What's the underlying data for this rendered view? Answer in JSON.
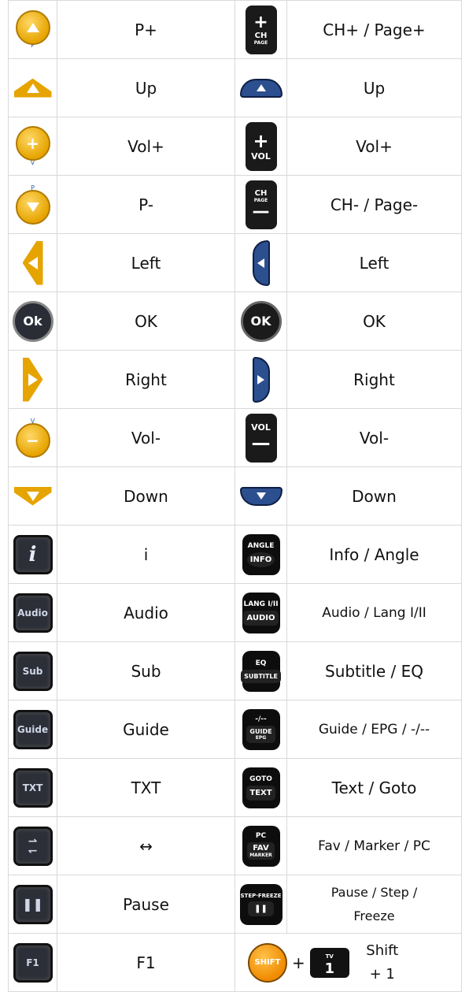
{
  "rows": [
    {
      "left_icon": "yellow-p-up-icon",
      "left_label": "P+",
      "right_icon": "ch-page-plus-icon",
      "right_label": "CH+ / Page+"
    },
    {
      "left_icon": "yellow-up-arrow-icon",
      "left_label": "Up",
      "right_icon": "blue-up-arrow-icon",
      "right_label": "Up"
    },
    {
      "left_icon": "yellow-vol-plus-icon",
      "left_label": "Vol+",
      "right_icon": "vol-plus-icon",
      "right_label": "Vol+"
    },
    {
      "left_icon": "yellow-p-down-icon",
      "left_label": "P-",
      "right_icon": "ch-page-minus-icon",
      "right_label": "CH- / Page-"
    },
    {
      "left_icon": "yellow-left-arrow-icon",
      "left_label": "Left",
      "right_icon": "blue-left-arrow-icon",
      "right_label": "Left"
    },
    {
      "left_icon": "ok-icon",
      "left_label": "OK",
      "right_icon": "ok-black-icon",
      "right_label": "OK"
    },
    {
      "left_icon": "yellow-right-arrow-icon",
      "left_label": "Right",
      "right_icon": "blue-right-arrow-icon",
      "right_label": "Right"
    },
    {
      "left_icon": "yellow-vol-minus-icon",
      "left_label": "Vol-",
      "right_icon": "vol-minus-icon",
      "right_label": "Vol-"
    },
    {
      "left_icon": "yellow-down-arrow-icon",
      "left_label": "Down",
      "right_icon": "blue-down-arrow-icon",
      "right_label": "Down"
    },
    {
      "left_icon": "info-i-icon",
      "left_label": "i",
      "right_icon": "info-angle-icon",
      "right_label": "Info / Angle"
    },
    {
      "left_icon": "audio-icon",
      "left_label": "Audio",
      "right_icon": "audio-lang-icon",
      "right_label": "Audio / Lang I/II"
    },
    {
      "left_icon": "sub-icon",
      "left_label": "Sub",
      "right_icon": "subtitle-eq-icon",
      "right_label": "Subtitle / EQ"
    },
    {
      "left_icon": "guide-icon",
      "left_label": "Guide",
      "right_icon": "guide-epg-icon",
      "right_label": "Guide / EPG / -/--"
    },
    {
      "left_icon": "txt-icon",
      "left_label": "TXT",
      "right_icon": "text-goto-icon",
      "right_label": "Text / Goto"
    },
    {
      "left_icon": "swap-arrows-icon",
      "left_label": "↔",
      "right_icon": "fav-marker-icon",
      "right_label": "Fav / Marker / PC"
    },
    {
      "left_icon": "pause-icon",
      "left_label": "Pause",
      "right_icon": "step-freeze-icon",
      "right_label": "Pause / Step / Freeze"
    },
    {
      "left_icon": "f1-icon",
      "left_label": "F1",
      "right_icon": "shift-plus-one-icon",
      "right_label": "Shift + 1"
    }
  ],
  "icons": {
    "p_letter": "P",
    "v_letter": "V",
    "ch": "CH",
    "page": "PAGE",
    "vol": "VOL",
    "ok_left": "Ok",
    "ok_right": "OK",
    "angle": "ANGLE",
    "info": "INFO",
    "lang": "LANG I/II",
    "audio_btn": "AUDIO",
    "audio_sq": "Audio",
    "eq": "EQ",
    "subtitle": "SUBTITLE",
    "sub_sq": "Sub",
    "dashes": "-/--",
    "guide_btn": "GUIDE",
    "epg": "EPG",
    "guide_sq": "Guide",
    "goto": "GOTO",
    "text_btn": "TEXT",
    "txt_sq": "TXT",
    "pc": "PC",
    "fav": "FAV",
    "marker": "MARKER",
    "step_freeze": "STEP·FREEZE",
    "f1_sq": "F1",
    "shift": "SHIFT",
    "tv": "TV",
    "one": "1",
    "plus": "+"
  },
  "colors": {
    "yellow": "#e6a400",
    "blue": "#2c4f8f",
    "black": "#111111",
    "orange": "#f08a00",
    "border": "#d9d9d9"
  }
}
